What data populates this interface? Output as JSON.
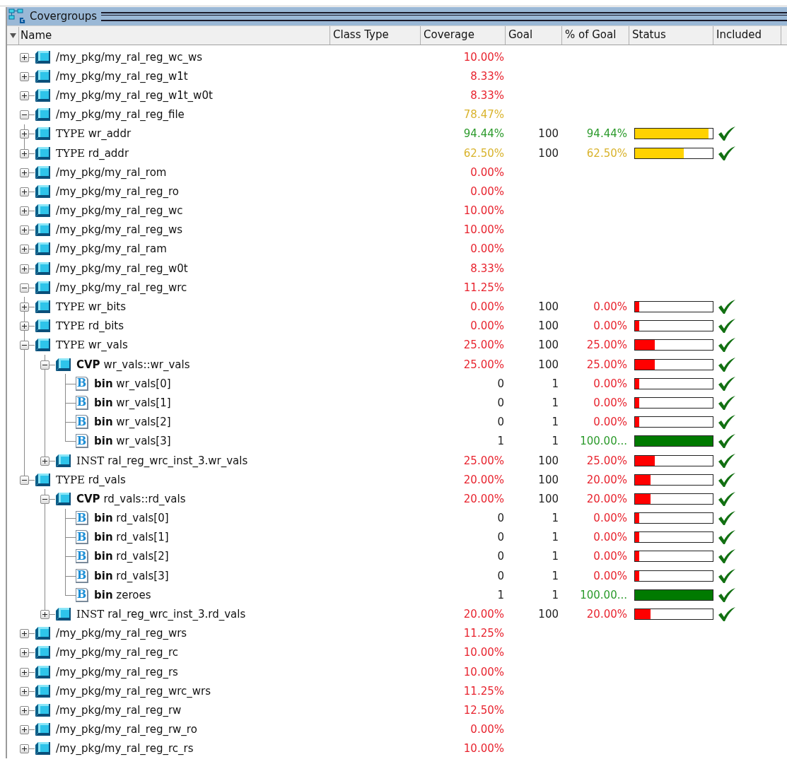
{
  "panel": {
    "title": "Covergroups"
  },
  "columns": [
    "Name",
    "Class Type",
    "Coverage",
    "Goal",
    "% of Goal",
    "Status",
    "Included"
  ],
  "rows": [
    {
      "kind": "group",
      "name": "/my_pkg/my_ral_reg_wc_ws",
      "expanded": false,
      "coverage": {
        "text": "10.00%",
        "color": "#e8232e"
      }
    },
    {
      "kind": "group",
      "name": "/my_pkg/my_ral_reg_w1t",
      "expanded": false,
      "coverage": {
        "text": "8.33%",
        "color": "#e8232e"
      }
    },
    {
      "kind": "group",
      "name": "/my_pkg/my_ral_reg_w1t_w0t",
      "expanded": false,
      "coverage": {
        "text": "8.33%",
        "color": "#e8232e"
      }
    },
    {
      "kind": "group",
      "name": "/my_pkg/my_ral_reg_file",
      "expanded": true,
      "coverage": {
        "text": "78.47%",
        "color": "#d9b32c"
      },
      "children": [
        {
          "kind": "type",
          "prefix": "TYPE",
          "name": "wr_addr",
          "expanded": false,
          "coverage": {
            "text": "94.44%",
            "color": "#2b9a2b"
          },
          "goal": "100",
          "pct_of_goal": {
            "text": "94.44%",
            "color": "#2b9a2b"
          },
          "status": {
            "level": 0.9444,
            "color": "#ffd200"
          },
          "included": true
        },
        {
          "kind": "type",
          "prefix": "TYPE",
          "name": "rd_addr",
          "expanded": false,
          "coverage": {
            "text": "62.50%",
            "color": "#d9b32c"
          },
          "goal": "100",
          "pct_of_goal": {
            "text": "62.50%",
            "color": "#d9b32c"
          },
          "status": {
            "level": 0.625,
            "color": "#ffd200"
          },
          "included": true
        }
      ]
    },
    {
      "kind": "group",
      "name": "/my_pkg/my_ral_rom",
      "expanded": false,
      "coverage": {
        "text": "0.00%",
        "color": "#e8232e"
      }
    },
    {
      "kind": "group",
      "name": "/my_pkg/my_ral_reg_ro",
      "expanded": false,
      "coverage": {
        "text": "0.00%",
        "color": "#e8232e"
      }
    },
    {
      "kind": "group",
      "name": "/my_pkg/my_ral_reg_wc",
      "expanded": false,
      "coverage": {
        "text": "10.00%",
        "color": "#e8232e"
      }
    },
    {
      "kind": "group",
      "name": "/my_pkg/my_ral_reg_ws",
      "expanded": false,
      "coverage": {
        "text": "10.00%",
        "color": "#e8232e"
      }
    },
    {
      "kind": "group",
      "name": "/my_pkg/my_ral_ram",
      "expanded": false,
      "coverage": {
        "text": "0.00%",
        "color": "#e8232e"
      }
    },
    {
      "kind": "group",
      "name": "/my_pkg/my_ral_reg_w0t",
      "expanded": false,
      "coverage": {
        "text": "8.33%",
        "color": "#e8232e"
      }
    },
    {
      "kind": "group",
      "name": "/my_pkg/my_ral_reg_wrc",
      "expanded": true,
      "coverage": {
        "text": "11.25%",
        "color": "#e8232e"
      },
      "children": [
        {
          "kind": "type",
          "prefix": "TYPE",
          "name": "wr_bits",
          "expanded": false,
          "coverage": {
            "text": "0.00%",
            "color": "#e8232e"
          },
          "goal": "100",
          "pct_of_goal": {
            "text": "0.00%",
            "color": "#e8232e"
          },
          "status": {
            "level": 0,
            "color": "#ff0000"
          },
          "included": true
        },
        {
          "kind": "type",
          "prefix": "TYPE",
          "name": "rd_bits",
          "expanded": false,
          "coverage": {
            "text": "0.00%",
            "color": "#e8232e"
          },
          "goal": "100",
          "pct_of_goal": {
            "text": "0.00%",
            "color": "#e8232e"
          },
          "status": {
            "level": 0,
            "color": "#ff0000"
          },
          "included": true
        },
        {
          "kind": "type",
          "prefix": "TYPE",
          "name": "wr_vals",
          "expanded": true,
          "coverage": {
            "text": "25.00%",
            "color": "#e8232e"
          },
          "goal": "100",
          "pct_of_goal": {
            "text": "25.00%",
            "color": "#e8232e"
          },
          "status": {
            "level": 0.25,
            "color": "#ff0000"
          },
          "included": true,
          "children": [
            {
              "kind": "cvp",
              "prefix": "CVP",
              "name": "wr_vals::wr_vals",
              "expanded": true,
              "coverage": {
                "text": "25.00%",
                "color": "#e8232e"
              },
              "goal": "100",
              "pct_of_goal": {
                "text": "25.00%",
                "color": "#e8232e"
              },
              "status": {
                "level": 0.25,
                "color": "#ff0000"
              },
              "included": true,
              "children": [
                {
                  "kind": "bin",
                  "icon": "B",
                  "prefix": "bin",
                  "name": "wr_vals[0]",
                  "coverage": {
                    "text": "0",
                    "color": "#222222"
                  },
                  "goal": "1",
                  "pct_of_goal": {
                    "text": "0.00%",
                    "color": "#e8232e"
                  },
                  "status": {
                    "level": 0,
                    "color": "#ff0000"
                  },
                  "included": true
                },
                {
                  "kind": "bin",
                  "icon": "B",
                  "prefix": "bin",
                  "name": "wr_vals[1]",
                  "coverage": {
                    "text": "0",
                    "color": "#222222"
                  },
                  "goal": "1",
                  "pct_of_goal": {
                    "text": "0.00%",
                    "color": "#e8232e"
                  },
                  "status": {
                    "level": 0,
                    "color": "#ff0000"
                  },
                  "included": true
                },
                {
                  "kind": "bin",
                  "icon": "B",
                  "prefix": "bin",
                  "name": "wr_vals[2]",
                  "coverage": {
                    "text": "0",
                    "color": "#222222"
                  },
                  "goal": "1",
                  "pct_of_goal": {
                    "text": "0.00%",
                    "color": "#e8232e"
                  },
                  "status": {
                    "level": 0,
                    "color": "#ff0000"
                  },
                  "included": true
                },
                {
                  "kind": "bin",
                  "icon": "B",
                  "prefix": "bin",
                  "name": "wr_vals[3]",
                  "coverage": {
                    "text": "1",
                    "color": "#222222"
                  },
                  "goal": "1",
                  "pct_of_goal": {
                    "text": "100.00...",
                    "color": "#2b9a2b"
                  },
                  "status": {
                    "level": 1,
                    "color": "#007a00"
                  },
                  "included": true
                }
              ]
            },
            {
              "kind": "inst",
              "prefix": "INST",
              "name": "ral_reg_wrc_inst_3.wr_vals",
              "expanded": false,
              "coverage": {
                "text": "25.00%",
                "color": "#e8232e"
              },
              "goal": "100",
              "pct_of_goal": {
                "text": "25.00%",
                "color": "#e8232e"
              },
              "status": {
                "level": 0.25,
                "color": "#ff0000"
              },
              "included": true
            }
          ]
        },
        {
          "kind": "type",
          "prefix": "TYPE",
          "name": "rd_vals",
          "expanded": true,
          "coverage": {
            "text": "20.00%",
            "color": "#e8232e"
          },
          "goal": "100",
          "pct_of_goal": {
            "text": "20.00%",
            "color": "#e8232e"
          },
          "status": {
            "level": 0.2,
            "color": "#ff0000"
          },
          "included": true,
          "children": [
            {
              "kind": "cvp",
              "prefix": "CVP",
              "name": "rd_vals::rd_vals",
              "expanded": true,
              "coverage": {
                "text": "20.00%",
                "color": "#e8232e"
              },
              "goal": "100",
              "pct_of_goal": {
                "text": "20.00%",
                "color": "#e8232e"
              },
              "status": {
                "level": 0.2,
                "color": "#ff0000"
              },
              "included": true,
              "children": [
                {
                  "kind": "bin",
                  "icon": "B",
                  "prefix": "bin",
                  "name": "rd_vals[0]",
                  "coverage": {
                    "text": "0",
                    "color": "#222222"
                  },
                  "goal": "1",
                  "pct_of_goal": {
                    "text": "0.00%",
                    "color": "#e8232e"
                  },
                  "status": {
                    "level": 0,
                    "color": "#ff0000"
                  },
                  "included": true
                },
                {
                  "kind": "bin",
                  "icon": "B",
                  "prefix": "bin",
                  "name": "rd_vals[1]",
                  "coverage": {
                    "text": "0",
                    "color": "#222222"
                  },
                  "goal": "1",
                  "pct_of_goal": {
                    "text": "0.00%",
                    "color": "#e8232e"
                  },
                  "status": {
                    "level": 0,
                    "color": "#ff0000"
                  },
                  "included": true
                },
                {
                  "kind": "bin",
                  "icon": "B",
                  "prefix": "bin",
                  "name": "rd_vals[2]",
                  "coverage": {
                    "text": "0",
                    "color": "#222222"
                  },
                  "goal": "1",
                  "pct_of_goal": {
                    "text": "0.00%",
                    "color": "#e8232e"
                  },
                  "status": {
                    "level": 0,
                    "color": "#ff0000"
                  },
                  "included": true
                },
                {
                  "kind": "bin",
                  "icon": "B",
                  "prefix": "bin",
                  "name": "rd_vals[3]",
                  "coverage": {
                    "text": "0",
                    "color": "#222222"
                  },
                  "goal": "1",
                  "pct_of_goal": {
                    "text": "0.00%",
                    "color": "#e8232e"
                  },
                  "status": {
                    "level": 0,
                    "color": "#ff0000"
                  },
                  "included": true
                },
                {
                  "kind": "bin",
                  "icon": "B",
                  "prefix": "bin",
                  "name": "zeroes",
                  "coverage": {
                    "text": "1",
                    "color": "#222222"
                  },
                  "goal": "1",
                  "pct_of_goal": {
                    "text": "100.00...",
                    "color": "#2b9a2b"
                  },
                  "status": {
                    "level": 1,
                    "color": "#007a00"
                  },
                  "included": true
                }
              ]
            },
            {
              "kind": "inst",
              "prefix": "INST",
              "name": "ral_reg_wrc_inst_3.rd_vals",
              "expanded": false,
              "coverage": {
                "text": "20.00%",
                "color": "#e8232e"
              },
              "goal": "100",
              "pct_of_goal": {
                "text": "20.00%",
                "color": "#e8232e"
              },
              "status": {
                "level": 0.2,
                "color": "#ff0000"
              },
              "included": true
            }
          ]
        }
      ]
    },
    {
      "kind": "group",
      "name": "/my_pkg/my_ral_reg_wrs",
      "expanded": false,
      "coverage": {
        "text": "11.25%",
        "color": "#e8232e"
      }
    },
    {
      "kind": "group",
      "name": "/my_pkg/my_ral_reg_rc",
      "expanded": false,
      "coverage": {
        "text": "10.00%",
        "color": "#e8232e"
      }
    },
    {
      "kind": "group",
      "name": "/my_pkg/my_ral_reg_rs",
      "expanded": false,
      "coverage": {
        "text": "10.00%",
        "color": "#e8232e"
      }
    },
    {
      "kind": "group",
      "name": "/my_pkg/my_ral_reg_wrc_wrs",
      "expanded": false,
      "coverage": {
        "text": "11.25%",
        "color": "#e8232e"
      }
    },
    {
      "kind": "group",
      "name": "/my_pkg/my_ral_reg_rw",
      "expanded": false,
      "coverage": {
        "text": "12.50%",
        "color": "#e8232e"
      }
    },
    {
      "kind": "group",
      "name": "/my_pkg/my_ral_reg_rw_ro",
      "expanded": false,
      "coverage": {
        "text": "0.00%",
        "color": "#e8232e"
      }
    },
    {
      "kind": "group",
      "name": "/my_pkg/my_ral_reg_rc_rs",
      "expanded": false,
      "coverage": {
        "text": "10.00%",
        "color": "#e8232e"
      }
    }
  ]
}
